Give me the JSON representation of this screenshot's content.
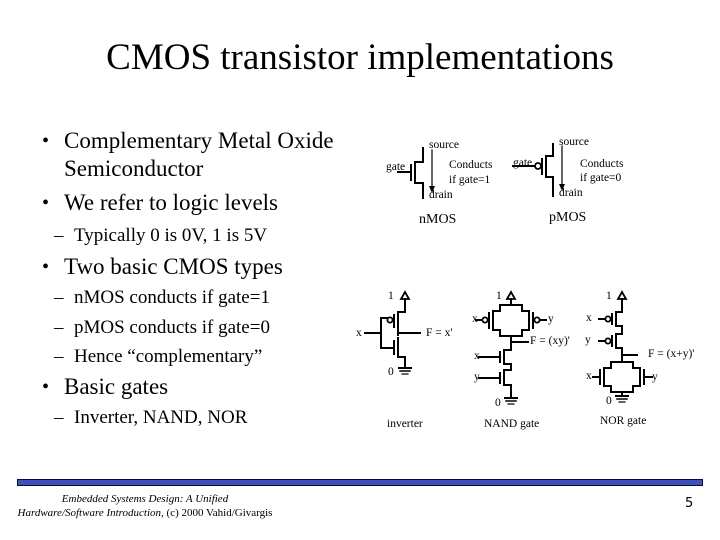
{
  "slide": {
    "title": "CMOS transistor implementations",
    "bullets": [
      {
        "text_line1": "Complementary Metal Oxide",
        "text_line2": "Semiconductor"
      },
      {
        "text": "We refer to logic levels",
        "sub": [
          "Typically 0 is 0V, 1 is 5V"
        ]
      },
      {
        "text": "Two basic CMOS types",
        "sub": [
          "nMOS conducts if gate=1",
          "pMOS conducts if gate=0",
          "Hence “complementary”"
        ]
      },
      {
        "text": "Basic gates",
        "sub": [
          "Inverter, NAND, NOR"
        ]
      }
    ],
    "bullet_glyph": "•",
    "dash_glyph": "–"
  },
  "transistors": {
    "nmos": {
      "source": "source",
      "gate": "gate",
      "drain": "drain",
      "note1": "Conducts",
      "note2": "if gate=1",
      "caption": "nMOS"
    },
    "pmos": {
      "source": "source",
      "gate": "gate",
      "drain": "drain",
      "note1": "Conducts",
      "note2": "if gate=0",
      "caption": "pMOS"
    }
  },
  "gates": {
    "inverter": {
      "vdd": "1",
      "gnd": "0",
      "input": "x",
      "output": "F = x'",
      "caption": "inverter"
    },
    "nand": {
      "vdd": "1",
      "gnd": "0",
      "in_x_top": "x",
      "in_y_top": "y",
      "in_x_bot": "x",
      "in_y_bot": "y",
      "output": "F = (xy)'",
      "caption": "NAND gate"
    },
    "nor": {
      "vdd": "1",
      "gnd": "0",
      "in_x_top": "x",
      "in_y_top": "y",
      "in_x_bot": "x",
      "in_y_bot": "y",
      "output": "F = (x+y)'",
      "caption": "NOR gate"
    }
  },
  "footer": {
    "line1": "Embedded Systems Design: A Unified",
    "line2_italic": "Hardware/Software Introduction,",
    "line2_rest": " (c) 2000 Vahid/Givargis",
    "page_number": "5",
    "bar_color": "#3b50c4"
  }
}
